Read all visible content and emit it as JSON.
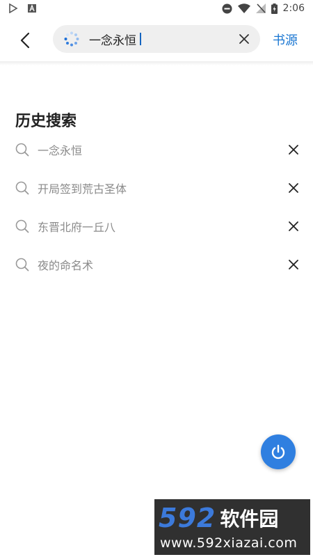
{
  "status_bar": {
    "time": "2:06",
    "left_icons": [
      "play-store-icon",
      "a-box-icon"
    ],
    "right_icons": [
      "do-not-disturb-icon",
      "wifi-icon",
      "no-signal-icon",
      "battery-charging-icon"
    ]
  },
  "header": {
    "search_value": "一念永恒",
    "source_label": "书源"
  },
  "history": {
    "title": "历史搜索",
    "items": [
      {
        "label": "一念永恒"
      },
      {
        "label": "开局签到荒古圣体"
      },
      {
        "label": "东晋北府一丘八"
      },
      {
        "label": "夜的命名术"
      }
    ]
  },
  "fab": {
    "icon": "power-icon"
  },
  "watermark": {
    "digits": "592",
    "brand": "软件园",
    "url": "www.592xiazai.com"
  },
  "colors": {
    "accent": "#1976d2",
    "fab": "#2f7fe0",
    "history_text": "#8a8a8a"
  }
}
